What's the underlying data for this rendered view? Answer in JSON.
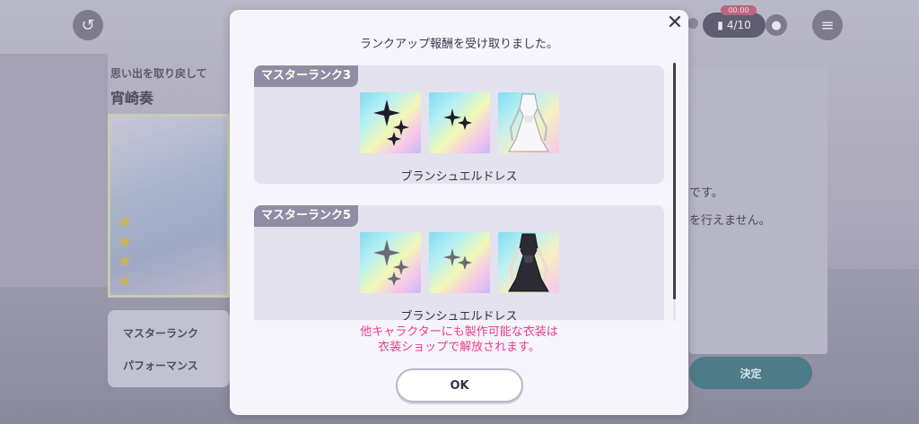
{
  "background": {
    "counter_tag": "00:00",
    "counter": "4/10",
    "subtitle": "思い出を取り戻して",
    "name": "宵崎奏",
    "info_rows": [
      "マスターランク",
      "パフォーマンス"
    ],
    "right_text": [
      "です。",
      "を行えません。"
    ],
    "decide_label": "決定"
  },
  "dialog": {
    "title": "ランクアップ報酬を受け取りました。",
    "close_icon": "close-icon",
    "sections": [
      {
        "tag": "マスターランク3",
        "item_name": "ブランシュエルドレス",
        "rewards": [
          "sparkle-material-icon",
          "sparkle-material-icon",
          "costume-white-dress-icon"
        ]
      },
      {
        "tag": "マスターランク5",
        "item_name": "ブランシュエルドレス",
        "rewards": [
          "sparkle-material-icon",
          "sparkle-material-icon",
          "costume-black-dress-icon"
        ]
      }
    ],
    "notice_line1": "他キャラクターにも製作可能な衣装は",
    "notice_line2": "衣装ショップで解放されます。",
    "ok_label": "OK"
  },
  "colors": {
    "notice": "#ee3a8d",
    "section_tag": "#8f8da3",
    "section_bg": "#e3e2ee"
  }
}
